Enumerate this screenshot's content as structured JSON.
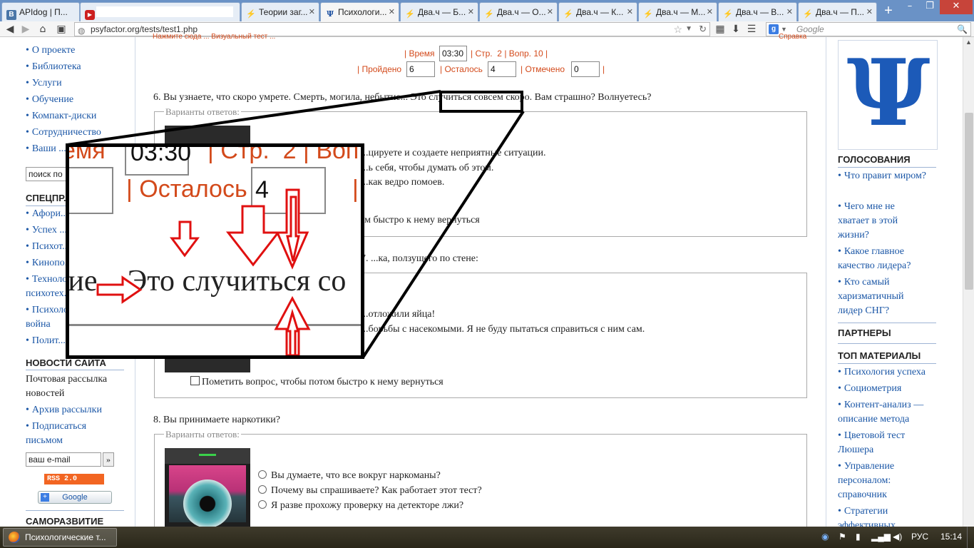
{
  "browser": {
    "tabs": [
      {
        "icon": "vk-icon",
        "label": "APIdog | П..."
      },
      {
        "icon": "youtube-icon",
        "label": ""
      },
      {
        "icon": "dvach-icon",
        "label": "Теории заг..."
      },
      {
        "icon": "psi-icon",
        "label": "Психологи..."
      },
      {
        "icon": "dvach-icon",
        "label": "Два.ч — Б..."
      },
      {
        "icon": "dvach-icon",
        "label": "Два.ч — О..."
      },
      {
        "icon": "dvach-icon",
        "label": "Два.ч — К..."
      },
      {
        "icon": "dvach-icon",
        "label": "Два.ч — М..."
      },
      {
        "icon": "dvach-icon",
        "label": "Два.ч — В..."
      },
      {
        "icon": "dvach-icon",
        "label": "Два.ч — П..."
      }
    ],
    "url": "psyfactor.org/tests/test1.php",
    "search_engine": "Google",
    "search_placeholder": "Google"
  },
  "left_sidebar": {
    "menu": [
      "О проекте",
      "Библиотека",
      "Услуги",
      "Обучение",
      "Компакт-диски",
      "Сотрудничество",
      "Ваши ..."
    ],
    "search_placeholder": "поиск по",
    "specpr_heading": "СПЕЦПР...",
    "specpr_items": [
      "Афори...",
      "Успех ...",
      "Психот...",
      "Кинопо...",
      "Техноло...",
      "психотех...",
      "Психоло...",
      "война",
      "Полит..."
    ],
    "news_heading": "НОВОСТИ САЙТА",
    "news_text": "Почтовая рассылка новостей",
    "news_links": [
      "Архив рассылки",
      "Подписаться письмом"
    ],
    "email_placeholder": "ваш e-mail",
    "email_go": "»",
    "rss_label": "RSS 2.0",
    "google_label": "Google",
    "selfdev_heading": "САМОРАЗВИТИЕ"
  },
  "test": {
    "header_cut": "Нажмите сюда ... Визуальный тест ...",
    "header_right": "Справка",
    "labels": {
      "time": "Время",
      "page": "Стр.",
      "question": "Вопр.",
      "passed": "Пройдено",
      "left": "Осталось",
      "marked": "Отмечено"
    },
    "time_value": "03:30",
    "page_value": "2",
    "question_value": "10",
    "passed_value": "6",
    "left_value": "4",
    "marked_value": "0",
    "legend": "Варианты ответов:",
    "mark_label": "Пометить вопрос, чтобы потом быстро к нему вернуться",
    "questions": [
      {
        "text": "6. Вы узнаете, что скоро умрете. Смерть, могила, небытие... Это случиться совсем скоро. Вам страшно? Волнуетесь?",
        "options": [
          "...цируете и создаете неприятные ситуации.",
          "...ь себя, чтобы думать об этом.",
          "...как ведро помоев."
        ]
      },
      {
        "text": "7. ...ка, ползущего по стене:",
        "options": [
          "...отложили яйца!",
          "...борьбы с насекомыми. Я не буду пытаться справиться с ним сам."
        ]
      },
      {
        "text": "8. Вы принимаете наркотики?",
        "options": [
          "Вы думаете, что все вокруг наркоманы?",
          "Почему вы спрашиваете? Как работает этот тест?",
          "Я разве прохожу проверку на детекторе лжи?"
        ]
      }
    ]
  },
  "right_sidebar": {
    "logo_glyph": "Ψ",
    "votes_heading": "ГОЛОСОВАНИЯ",
    "votes": [
      "Что правит миром?",
      "Чего мне не хватает в этой жизни?",
      "Какое главное качество лидера?",
      "Кто самый харизматичный лидер СНГ?"
    ],
    "partners_heading": "ПАРТНЕРЫ",
    "top_heading": "ТОП МАТЕРИАЛЫ",
    "top_items": [
      "Психология успеха",
      "Социометрия",
      "Контент-анализ — описание метода",
      "Цветовой тест Люшера",
      "Управление персоналом: справочник",
      "Стратегии эффективных..."
    ]
  },
  "zoom_overlay": {
    "time_value": "03:30",
    "page_label": "Стр.",
    "page_value": "2",
    "left_label": "Осталось",
    "left_value": "4",
    "time_label_cut": "емя",
    "vop_cut": "Воп",
    "sentence": "Это случиться со",
    "prev_word_cut": "тие..."
  },
  "taskbar": {
    "app_label": "Психологические т...",
    "lang": "РУС",
    "clock": "15:14"
  }
}
